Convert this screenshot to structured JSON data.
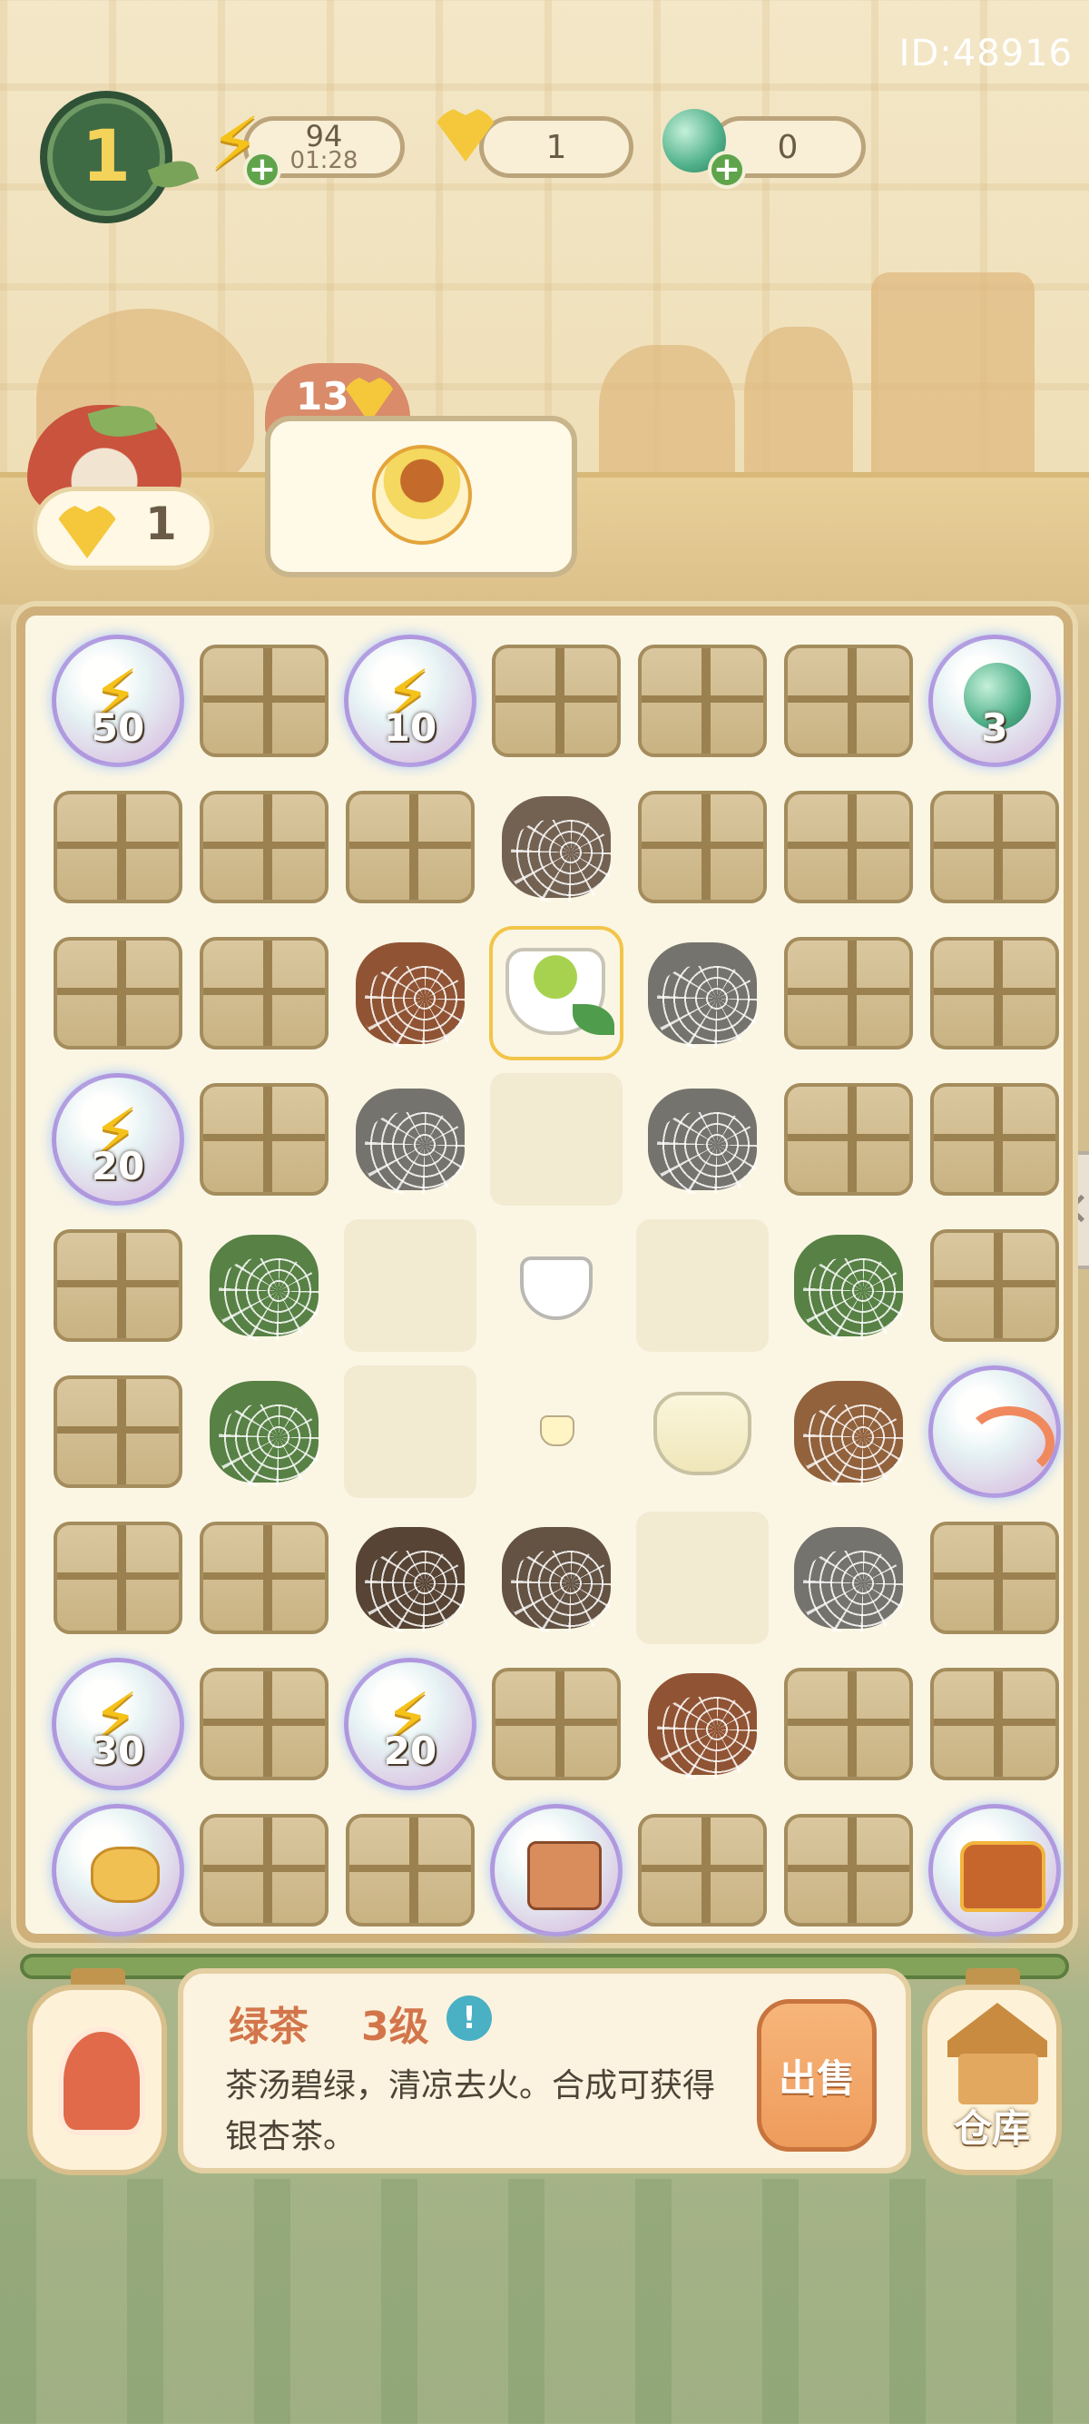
{
  "header": {
    "player_id": "ID:48916",
    "level": "1",
    "energy": {
      "value": "94",
      "timer": "01:28"
    },
    "ginkgo": {
      "value": "1"
    },
    "jade": {
      "value": "0"
    }
  },
  "panda": {
    "count": "1"
  },
  "order": {
    "reward": "13"
  },
  "board": {
    "rows": [
      [
        "bubble-energy-50",
        "crate",
        "bubble-energy-10",
        "crate",
        "crate",
        "crate",
        "bubble-jade-3"
      ],
      [
        "crate",
        "crate",
        "crate",
        "webbed-teapot",
        "crate",
        "crate",
        "crate"
      ],
      [
        "crate",
        "crate",
        "webbed-brush",
        "green-tea",
        "webbed-pot",
        "crate",
        "crate"
      ],
      [
        "bubble-energy-20",
        "crate",
        "webbed-pot",
        "empty",
        "webbed-pot",
        "crate",
        "crate"
      ],
      [
        "crate",
        "webbed-leaf",
        "empty",
        "white-cup",
        "empty",
        "webbed-leaf",
        "crate"
      ],
      [
        "crate",
        "webbed-leaf",
        "empty",
        "tiny-cup",
        "pitcher",
        "webbed-fruit",
        "bubble-shrimp"
      ],
      [
        "crate",
        "crate",
        "webbed-cake",
        "webbed-dish",
        "empty",
        "webbed-pot",
        "crate"
      ],
      [
        "bubble-energy-30",
        "crate",
        "bubble-energy-20",
        "crate",
        "webbed-brush",
        "crate",
        "crate"
      ],
      [
        "bubble-frog",
        "crate",
        "crate",
        "bubble-cake",
        "crate",
        "crate",
        "bubble-chest"
      ]
    ],
    "bubble_values": {
      "energy-50": "50",
      "energy-10": "10",
      "jade-3": "3",
      "energy-20": "20",
      "energy-30": "30"
    }
  },
  "info": {
    "item_name": "绿茶",
    "item_level": "3级",
    "info_icon": "!",
    "description": "茶汤碧绿，清凉去火。合成可获得银杏茶。",
    "sell_label": "出售"
  },
  "warehouse": {
    "label": "仓库"
  },
  "colors": {
    "accent": "#d3754b",
    "board_border": "#cfb07a",
    "sell": "#ee9c5c"
  }
}
